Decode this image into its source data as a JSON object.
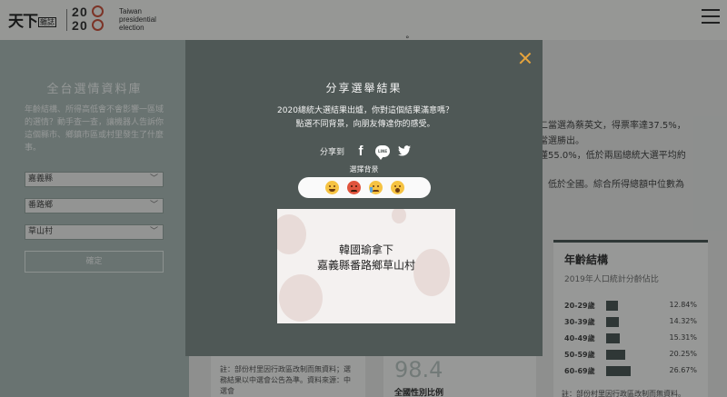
{
  "brand": {
    "cw_logo": "天下",
    "cw_logo_small": "雜誌",
    "year_digits": [
      "2",
      "0",
      "2",
      "0"
    ],
    "event_lines": [
      "Taiwan",
      "presidential",
      "election"
    ]
  },
  "sidebar": {
    "title": "全台選情資料庫",
    "description": "年齡結構、所得高低會不會影響一區域的選情？動手查一查，讓機器人告訴你這個縣市、鄉鎮市區或村里發生了什麼事。",
    "county": "嘉義縣",
    "township": "番路鄉",
    "village": "草山村",
    "confirm_label": "確定"
  },
  "article": {
    "lines": [
      "二當選為蔡英文，得票率達37.5%，",
      "當選勝出。",
      "僅55.0%，低於兩屆總統大選平均約",
      "，低於全國。綜合所得總額中位數為"
    ],
    "note": "註：部份村里因行政區改制而無資料；選務結果以中選會公告為準。資料來源：中選會",
    "gender_value": "98.4",
    "gender_label": "全國性別比例",
    "right_note": "註：部份村里因行政區改制而無資料。"
  },
  "age_card": {
    "title": "年齡結構",
    "subtitle": "2019年人口統計分齡佔比",
    "rows": [
      {
        "label": "20-29歲",
        "pct": "12.84%",
        "value": 12.84
      },
      {
        "label": "30-39歲",
        "pct": "14.32%",
        "value": 14.32
      },
      {
        "label": "40-49歲",
        "pct": "15.31%",
        "value": 15.31
      },
      {
        "label": "50-59歲",
        "pct": "20.25%",
        "value": 20.25
      },
      {
        "label": "60-69歲",
        "pct": "26.67%",
        "value": 26.67
      }
    ]
  },
  "modal": {
    "title": "分享選舉結果",
    "description": "2020總統大選結果出爐，你對這個結果滿意嗎？點選不同背景，向朋友傳達你的感受。",
    "share_label": "分享到",
    "line_icon_text": "LINE",
    "bg_label": "選擇背景",
    "emojis": [
      "laughing-emoji",
      "angry-emoji",
      "crying-emoji",
      "shocked-emoji"
    ],
    "preview_line1": "韓國瑜拿下",
    "preview_line2": "嘉義縣番路鄉草山村"
  },
  "colors": {
    "close_accent": "#e7a43c",
    "sidebar_bg": "#a7b7b3",
    "modal_bg": "#4f5856",
    "bar_color": "#3c4a47"
  }
}
